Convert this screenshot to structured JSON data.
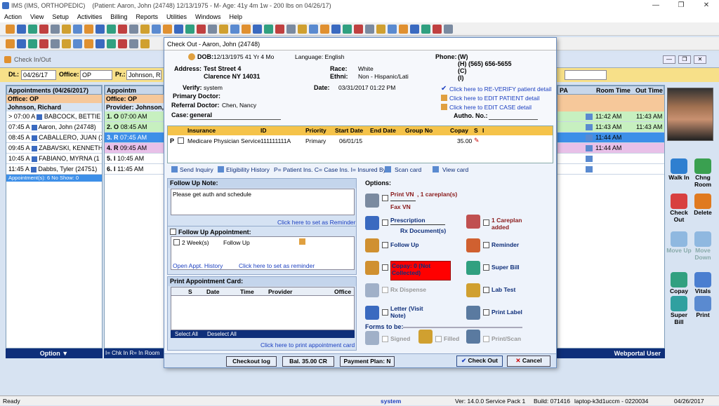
{
  "title_bar": {
    "app": "IMS (IMS, ORTHOPEDIC)",
    "patient_info": "(Patient: Aaron, John  (24748) 12/13/1975 - M- Age: 41y 4m 1w - 200 lbs on 04/26/17)"
  },
  "menu": [
    "Action",
    "View",
    "Setup",
    "Activities",
    "Billing",
    "Reports",
    "Utilities",
    "Windows",
    "Help"
  ],
  "checkin": {
    "window_title": "Check In/Out",
    "dt_label": "Dt.:",
    "dt_value": "04/26/17",
    "office_label": "Office:",
    "office_value": "OP",
    "pr_label": "Pr.:",
    "pr_value": "Johnson, R",
    "appt_header": "Appointments (04/26/2017)",
    "appt_header2": "Appointm",
    "office_row": "Office: OP",
    "office_row2": "Office: OP",
    "provider_row": "Johnson, Richard",
    "provider_row2": "Provider: Johnson,",
    "left_rows": [
      {
        "time": "07:00 A",
        "name": "BABCOCK, BETTIE  (5",
        "color": "#ffffff",
        "marker": ">"
      },
      {
        "time": "07:45 A",
        "name": "Aaron, John  (24748)",
        "color": "#ffffff",
        "marker": ""
      },
      {
        "time": "08:45 A",
        "name": "CABALLERO, JUAN  (103",
        "color": "#ffffff",
        "marker": ""
      },
      {
        "time": "09:45 A",
        "name": "ZABAVSKI, KENNETH  (1",
        "color": "#ffffff",
        "marker": ""
      },
      {
        "time": "10:45 A",
        "name": "FABIANO, MYRNA  (1",
        "color": "#ffffff",
        "marker": ""
      },
      {
        "time": "11:45 A",
        "name": "Dabbs, Tyler  (24751)",
        "color": "#ffffff",
        "marker": ""
      }
    ],
    "mid_rows": [
      {
        "num": "1.",
        "st": "O",
        "time": "07:00 AM",
        "color": "#c7f0c0"
      },
      {
        "num": "2.",
        "st": "O",
        "time": "08:45 AM",
        "color": "#c7f0c0"
      },
      {
        "num": "3.",
        "st": "R",
        "time": "07:45 AM",
        "color": "#3d8fe8"
      },
      {
        "num": "4.",
        "st": "R",
        "time": "09:45 AM",
        "color": "#e8c0e8"
      },
      {
        "num": "5.",
        "st": "I",
        "time": "10:45 AM",
        "color": "#ffffff"
      },
      {
        "num": "6.",
        "st": "I",
        "time": "11:45 AM",
        "color": "#ffffff"
      }
    ],
    "summary": "Appointment(s): 6   No Show: 0",
    "col_pa": "PA",
    "col_roomtime": "Room Time",
    "col_outtime": "Out Time",
    "right_rows": [
      {
        "room": "11:42 AM",
        "out": "11:43 AM",
        "color": "#c7f0c0"
      },
      {
        "room": "11:43 AM",
        "out": "11:43 AM",
        "color": "#c7f0c0"
      },
      {
        "room": "11:44 AM",
        "out": "",
        "color": "#3d8fe8"
      },
      {
        "room": "11:44 AM",
        "out": "",
        "color": "#e8c0e8"
      },
      {
        "room": "",
        "out": "",
        "color": "#ffffff"
      },
      {
        "room": "",
        "out": "",
        "color": "#ffffff"
      }
    ],
    "option_btn": "Option",
    "legend": "I= Chk In  R= In Room",
    "webportal": "Webportal User"
  },
  "right_buttons": [
    {
      "label": "Walk In",
      "color": "#2f7fd0"
    },
    {
      "label": "Chng Room",
      "color": "#3aa050"
    },
    {
      "label": "Check Out",
      "color": "#d84040"
    },
    {
      "label": "Delete",
      "color": "#e07a20"
    },
    {
      "label": "Move Up",
      "color": "#8fb8e0"
    },
    {
      "label": "Move Down",
      "color": "#8fb8e0"
    },
    {
      "label": "Copay",
      "color": "#30a080"
    },
    {
      "label": "Vitals",
      "color": "#4a7ed0"
    },
    {
      "label": "Super Bill",
      "color": "#30a0a0"
    },
    {
      "label": "Print",
      "color": "#5a8ad0"
    }
  ],
  "dialog": {
    "title": "Check Out - Aaron, John  (24748)",
    "dob_label": "DOB:",
    "dob": "12/13/1975 41 Yr 4 Mo",
    "language": "Language: English",
    "phone_label": "Phone:",
    "phones": [
      "(W)",
      "(H)  (565) 656-5655",
      "(C)",
      "(I)"
    ],
    "address_label": "Address:",
    "address1": "Test Street 4",
    "address2": "Clarence  NY  14031",
    "race_label": "Race:",
    "race": "White",
    "ethni_label": "Ethni:",
    "ethni": "Non - Hispanic/Lati",
    "verify_label": "Verify:",
    "verify": "system",
    "date_label": "Date:",
    "date": "03/31/2017 01:22 PM",
    "primary_doctor": "Primary Doctor:",
    "referral_label": "Referral Doctor:",
    "referral": "Chen, Nancy",
    "case_label": "Case:",
    "case": "general",
    "autho_label": "Autho. No.:",
    "link_reverify": "Click here to RE-VERIFY patient detail",
    "link_edit_patient": "Click here to EDIT PATIENT detail",
    "link_edit_case": "Click here to EDIT CASE detail",
    "ins_headers": [
      "Insurance",
      "ID",
      "Priority",
      "Start Date",
      "End Date",
      "Group No",
      "Copay",
      "S",
      "I"
    ],
    "ins_row": {
      "type": "P",
      "insurance": "Medicare Physician Service",
      "id": "111111111A",
      "priority": "Primary",
      "start": "06/01/15",
      "end": "",
      "group": "",
      "copay": "35.00"
    },
    "send_inquiry": "Send Inquiry",
    "eligibility": "Eligibility History",
    "legend": "P= Patient Ins. C= Case Ins. I= Insured By",
    "scan_card": "Scan card",
    "view_card": "View card",
    "followup_note_label": "Follow Up Note:",
    "followup_note": "Please get auth and schedule",
    "set_reminder": "Click here to set as Reminder",
    "followup_appt_label": "Follow Up Appointment:",
    "followup_weeks": "2  Week(s)",
    "followup_type": "Follow Up",
    "open_history": "Open Appt. History",
    "set_reminder2": "Click here to set as reminder",
    "print_card_label": "Print Appointment Card:",
    "card_headers": [
      "S",
      "Date",
      "Time",
      "Provider",
      "Office"
    ],
    "select_all": "Select All",
    "deselect_all": "Deselect All",
    "print_card_link": "Click here to print appointment card",
    "options_label": "Options:",
    "print_vn": "Print VN",
    "careplans": ", 1 careplan(s)",
    "fax_vn": "Fax VN",
    "prescription": "Prescription",
    "rx_documents": "Rx Document(s)",
    "careplan_added": "1 Careplan added",
    "follow_up": "Follow Up",
    "reminder": "Reminder",
    "copay": "Copay: 0 (Not Collected)",
    "super_bill": "Super Bill",
    "rx_dispense": "Rx Dispense",
    "lab_test": "Lab Test",
    "letter": "Letter (Visit Note)",
    "print_label": "Print Label",
    "forms_label": "Forms to be:",
    "signed": "Signed",
    "filled": "Filled",
    "print_scan": "Print/Scan",
    "checkout_log": "Checkout log",
    "balance": "Bal. 35.00 CR",
    "payment_plan": "Payment Plan: N",
    "check_out": "Check Out",
    "cancel": "Cancel"
  },
  "status_bar": {
    "ready": "Ready",
    "user": "system",
    "version": "Ver: 14.0.0 Service Pack 1",
    "build": "Build: 071416",
    "machine": "laptop-k3d1uccm - 0220034",
    "date": "04/26/2017"
  },
  "colors": {
    "accent": "#3d8fe8",
    "copay_bg": "#ff0000",
    "dark_blue": "#0f2f7a"
  }
}
